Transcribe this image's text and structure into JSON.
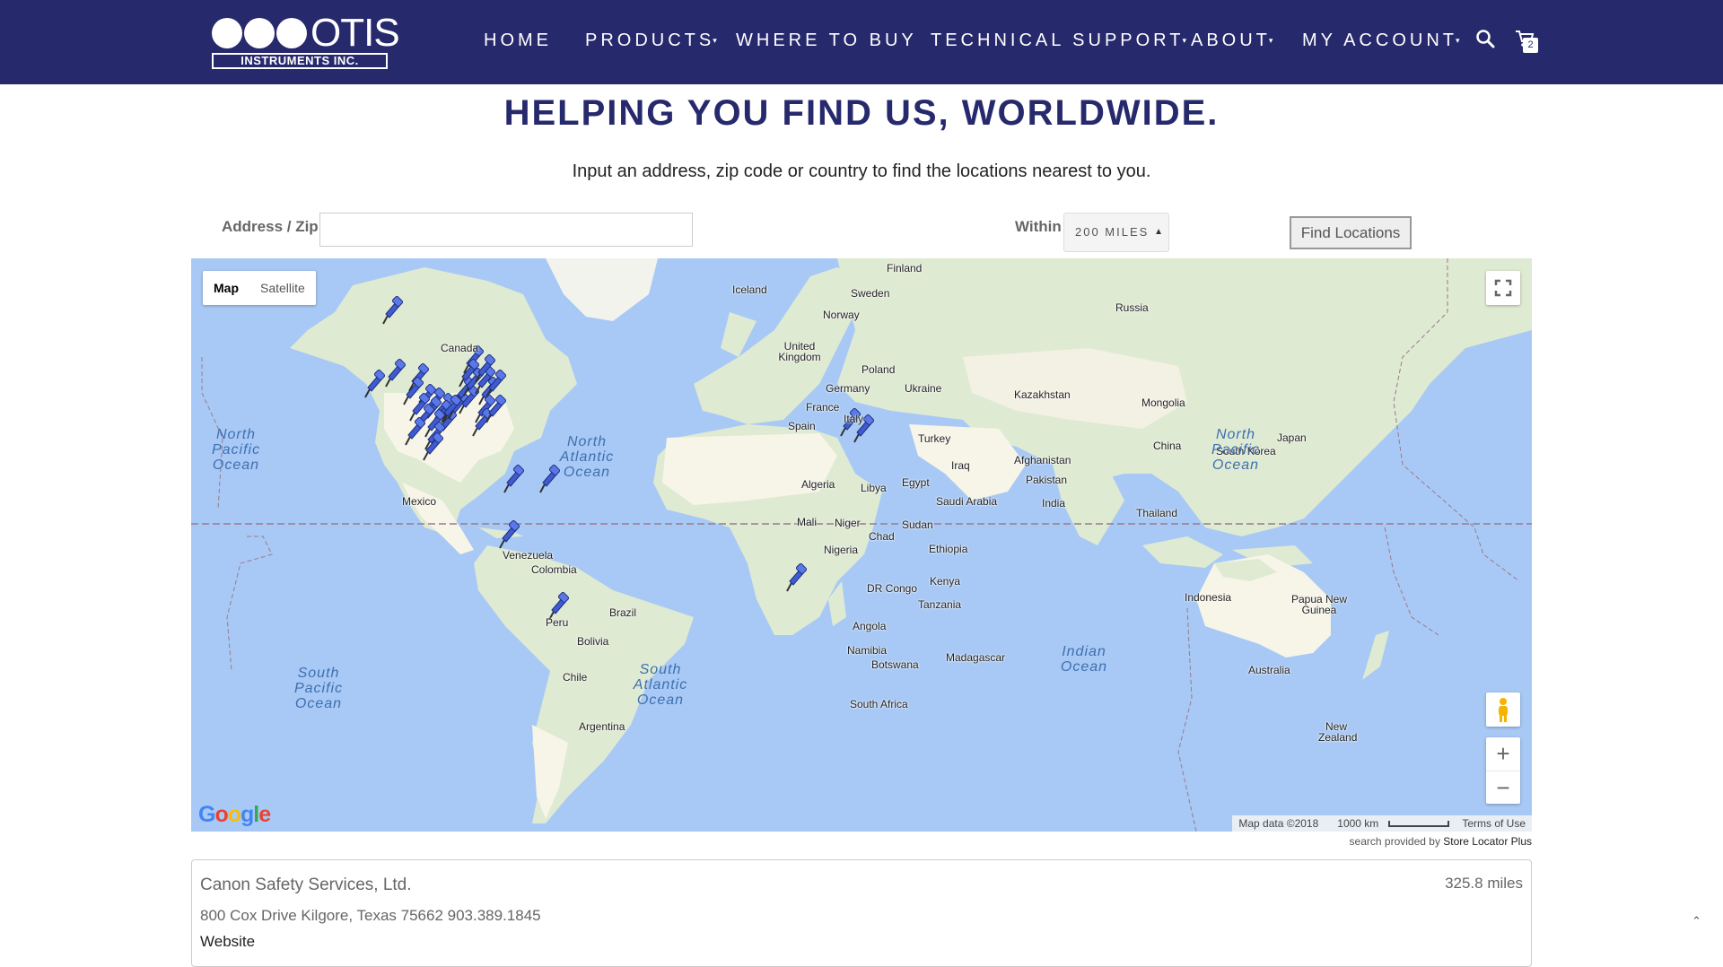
{
  "header": {
    "logo_word": "OTIS",
    "logo_sub": "INSTRUMENTS INC.",
    "nav": [
      {
        "label": "HOME",
        "has_dropdown": false
      },
      {
        "label": "PRODUCTS",
        "has_dropdown": true
      },
      {
        "label": "WHERE TO BUY",
        "has_dropdown": false
      },
      {
        "label": "TECHNICAL SUPPORT",
        "has_dropdown": true
      },
      {
        "label": "ABOUT",
        "has_dropdown": true
      },
      {
        "label": "MY ACCOUNT",
        "has_dropdown": true
      }
    ],
    "cart_count": "2",
    "icons": {
      "search": "search-icon",
      "cart": "cart-icon"
    },
    "bg_color": "#27296d"
  },
  "page": {
    "title": "HELPING YOU FIND US, WORLDWIDE.",
    "subtitle": "Input an address, zip code or country to find the locations nearest to you."
  },
  "search": {
    "address_label": "Address / Zip",
    "address_value": "",
    "within_label": "Within",
    "within_value": "200 MILES",
    "find_button": "Find Locations"
  },
  "map": {
    "type_buttons": [
      "Map",
      "Satellite"
    ],
    "active_type": "Map",
    "google": "Google",
    "attribution": {
      "map_data": "Map data ©2018",
      "scale": "1000 km",
      "terms": "Terms of Use"
    },
    "provided_prefix": "search provided by",
    "provided_name": "Store Locator Plus",
    "country_labels": [
      "Finland",
      "Iceland",
      "Sweden",
      "Norway",
      "Russia",
      "Canada",
      "United Kingdom",
      "Poland",
      "Germany",
      "Ukraine",
      "France",
      "Kazakhstan",
      "Mongolia",
      "Italy",
      "Spain",
      "Turkey",
      "China",
      "South Korea",
      "Japan",
      "Afghanistan",
      "Iraq",
      "Pakistan",
      "Algeria",
      "Libya",
      "Egypt",
      "Saudi Arabia",
      "India",
      "Thailand",
      "Mali",
      "Niger",
      "Sudan",
      "Chad",
      "Nigeria",
      "Ethiopia",
      "Mexico",
      "Venezuela",
      "Colombia",
      "Kenya",
      "DR Congo",
      "Tanzania",
      "Indonesia",
      "Papua New Guinea",
      "Brazil",
      "Peru",
      "Bolivia",
      "Angola",
      "Namibia",
      "Botswana",
      "Madagascar",
      "Australia",
      "Chile",
      "South Africa",
      "Argentina",
      "New Zealand"
    ],
    "ocean_labels": [
      "North Pacific Ocean",
      "North Atlantic Ocean",
      "North Pacific Ocean",
      "South Pacific Ocean",
      "South Atlantic Ocean",
      "Indian Ocean"
    ],
    "marker_count": 39
  },
  "result": {
    "name": "Canon Safety Services, Ltd.",
    "distance": "325.8 miles",
    "address": "800 Cox Drive Kilgore, Texas 75662 903.389.1845",
    "website": "Website"
  }
}
